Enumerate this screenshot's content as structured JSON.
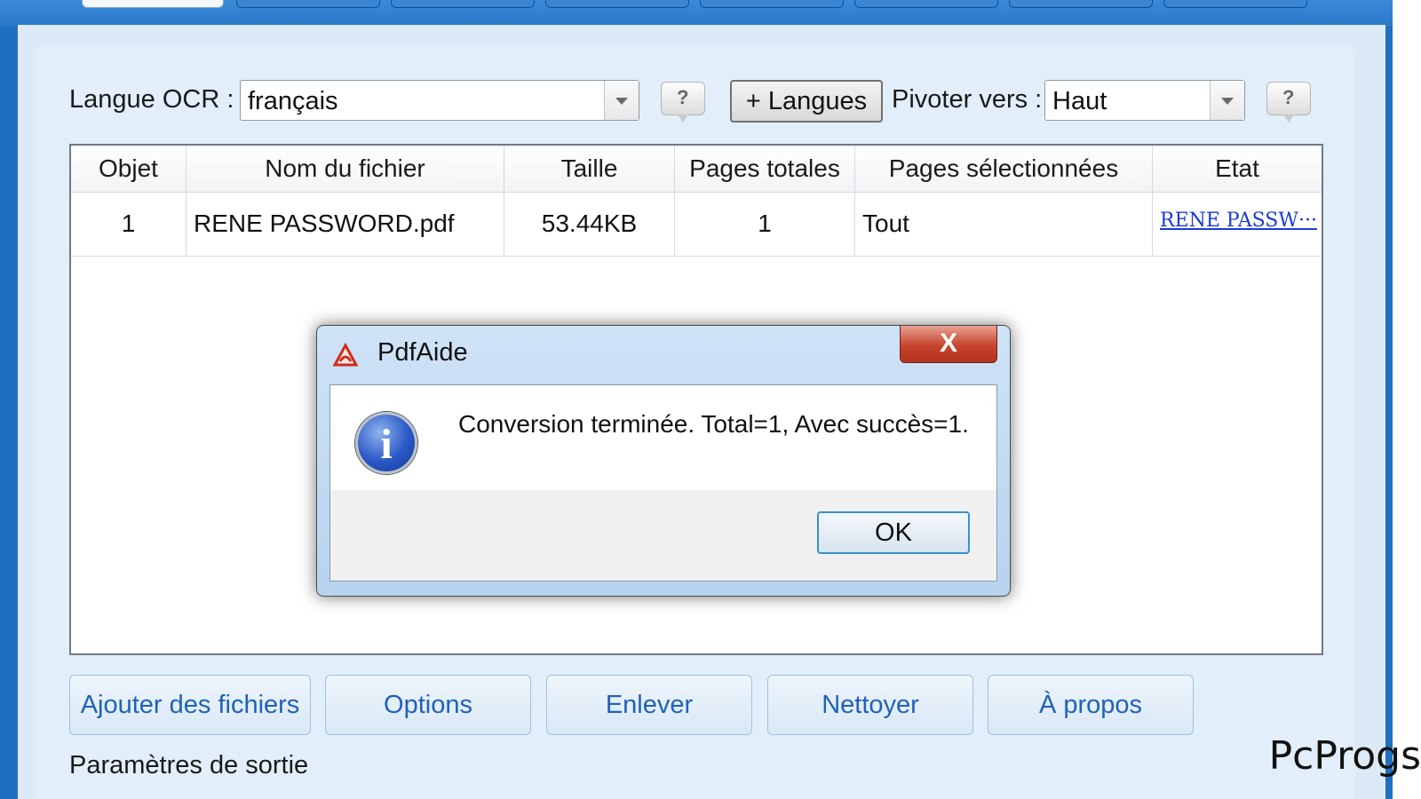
{
  "ocr": {
    "label": "Langue OCR :",
    "value": "français",
    "help_label": "?"
  },
  "toolbar": {
    "add_languages_label": "+ Langues"
  },
  "rotate": {
    "label": "Pivoter vers :",
    "value": "Haut",
    "help_label": "?"
  },
  "table": {
    "headers": [
      "Objet",
      "Nom du fichier",
      "Taille",
      "Pages totales",
      "Pages sélectionnées",
      "Etat"
    ],
    "rows": [
      {
        "item": "1",
        "filename": "RENE PASSWORD.pdf",
        "size": "53.44KB",
        "total_pages": "1",
        "selected_pages": "Tout",
        "status": "RENE PASSW···"
      }
    ]
  },
  "buttons": {
    "add_files": "Ajouter des fichiers",
    "options": "Options",
    "remove": "Enlever",
    "clear": "Nettoyer",
    "about": "À propos"
  },
  "output": {
    "section_label": "Paramètres de sortie"
  },
  "dialog": {
    "title": "PdfAide",
    "close_label": "X",
    "info_glyph": "i",
    "message": "Conversion terminée. Total=1, Avec succès=1.",
    "ok_label": "OK"
  },
  "watermark": "PcProgs",
  "colors": {
    "accent": "#1f62b8",
    "link": "#1a3bd6",
    "close": "#c6432c"
  }
}
